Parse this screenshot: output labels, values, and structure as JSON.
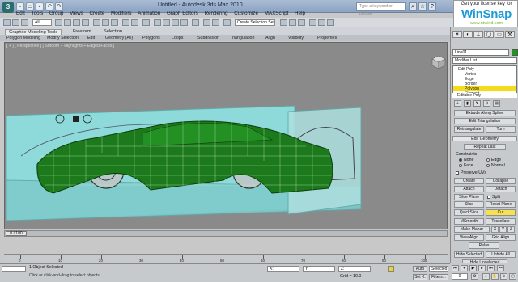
{
  "titlebar": {
    "logo": "3",
    "title": "Untitled - Autodesk 3ds Max 2010",
    "search_placeholder": "Type a keyword or phrase"
  },
  "menu": [
    "Edit",
    "Tools",
    "Group",
    "Views",
    "Create",
    "Modifiers",
    "Animation",
    "Graph Editors",
    "Rendering",
    "Customize",
    "MAXScript",
    "Help"
  ],
  "toolbar": {
    "select_filter": "All",
    "named_selection": "Create Selection Set"
  },
  "ribbon": {
    "tabs": [
      "Graphite Modeling Tools",
      "Freeform",
      "Selection"
    ],
    "row": [
      "Polygon Modeling",
      "Modify Selection",
      "Edit",
      "Geometry (All)",
      "Polygons",
      "Loops",
      "Subdivision",
      "Triangulation",
      "Align",
      "Visibility",
      "Properties"
    ]
  },
  "viewport": {
    "label": "[ + ] [ Perspective ] [ Smooth + Highlights + Edged Faces ]",
    "mesh_color": "#1c7a1c",
    "plane_color": "#8ed9d9"
  },
  "winsnap": {
    "tagline": "Get your license key for",
    "name": "WinSnap",
    "url": "www.ntwind.com"
  },
  "command_panel": {
    "object_name": "Line01",
    "object_color": "#1a9a1a",
    "modifier_list": "Modifier List",
    "stack": [
      "Edit Poly",
      "Vertex",
      "Edge",
      "Border",
      "Polygon",
      "Element",
      "Editable Poly",
      "Vertex"
    ],
    "selected_stack_item": "Polygon",
    "rollouts": {
      "extrude_spline": "Extrude Along Spline",
      "edit_triangulation": "Edit Triangulation",
      "retriangulate": "Retriangulate",
      "turn": "Turn",
      "edit_geometry": "Edit Geometry",
      "repeat_last": "Repeat Last",
      "constraints": "Constraints",
      "none": "None",
      "edge": "Edge",
      "face": "Face",
      "normal": "Normal",
      "preserve_uvs": "Preserve UVs",
      "create": "Create",
      "collapse": "Collapse",
      "attach": "Attach",
      "detach": "Detach",
      "slice_plane": "Slice Plane",
      "split": "Split",
      "slice": "Slice",
      "reset_plane": "Reset Plane",
      "quickslice": "QuickSlice",
      "cut": "Cut",
      "msmooth": "MSmooth",
      "tessellate": "Tessellate",
      "make_planar": "Make Planar",
      "x": "X",
      "y": "Y",
      "z": "Z",
      "view_align": "View Align",
      "grid_align": "Grid Align",
      "relax": "Relax",
      "hide_selected": "Hide Selected",
      "unhide_all": "Unhide All",
      "hide_unselected": "Hide Unselected"
    }
  },
  "time": {
    "slider": "0 / 100",
    "ticks": [
      "0",
      "10",
      "20",
      "30",
      "40",
      "50",
      "60",
      "70",
      "80",
      "90",
      "100"
    ]
  },
  "status": {
    "maxscript": "",
    "line1": "1 Object Selected",
    "line2": "Click or click-and-drag to select objects",
    "x": "X:",
    "y": "Y:",
    "z": "Z:",
    "grid": "Grid = 10.0",
    "auto_key": "Auto",
    "selected": "Selected",
    "set_key": "Set K.",
    "key_filters": "Filters...",
    "frame": "0"
  }
}
